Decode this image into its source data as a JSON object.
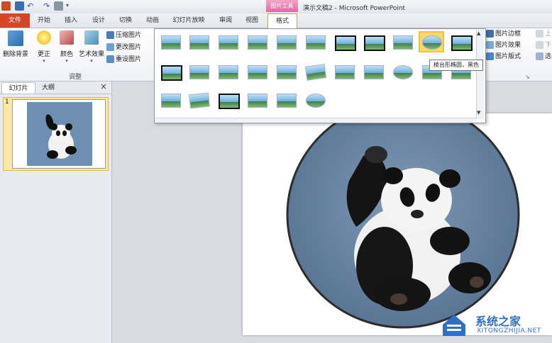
{
  "window": {
    "title": "演示文稿2 - Microsoft PowerPoint"
  },
  "context_tab": {
    "label": "图片工具"
  },
  "tabs": [
    {
      "label": "文件"
    },
    {
      "label": "开始"
    },
    {
      "label": "插入"
    },
    {
      "label": "设计"
    },
    {
      "label": "切换"
    },
    {
      "label": "动画"
    },
    {
      "label": "幻灯片放映"
    },
    {
      "label": "审阅"
    },
    {
      "label": "视图"
    },
    {
      "label": "格式"
    }
  ],
  "ribbon": {
    "remove_bg": "删除背景",
    "corrections": "更正",
    "color": "颜色",
    "artistic": "艺术效果",
    "compress": "压缩图片",
    "change": "更改图片",
    "reset": "重设图片",
    "group_adjust": "调整",
    "border": "图片边框",
    "effects": "图片效果",
    "layout": "图片版式",
    "right_cut_1": "上",
    "right_cut_2": "下",
    "right_cut_3": "选"
  },
  "left_panel": {
    "tab_slides": "幻灯片",
    "tab_outline": "大纲",
    "close": "×",
    "slide_number": "1"
  },
  "gallery": {
    "tooltip": "棱台形椭圆，黑色"
  },
  "watermark": {
    "brand": "系统之家",
    "domain": "XITONGZHIJIA.NET"
  },
  "colors": {
    "file_tab": "#d24726",
    "context_pink": "#e168a0",
    "highlight": "#fbd86a"
  }
}
